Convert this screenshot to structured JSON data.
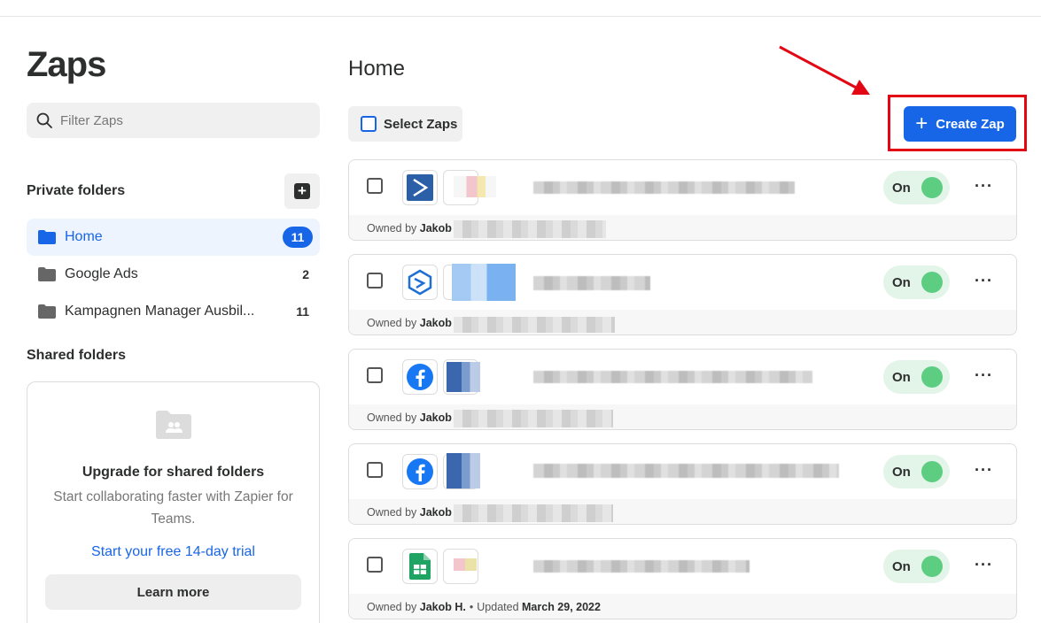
{
  "sidebar": {
    "title": "Zaps",
    "filter_placeholder": "Filter Zaps",
    "private_folders_label": "Private folders",
    "folders": [
      {
        "name": "Home",
        "count": "11",
        "active": true
      },
      {
        "name": "Google Ads",
        "count": "2",
        "active": false
      },
      {
        "name": "Kampagnen Manager Ausbil...",
        "count": "11",
        "active": false
      }
    ],
    "shared_folders_label": "Shared folders",
    "upgrade": {
      "heading": "Upgrade for shared folders",
      "body": "Start collaborating faster with Zapier for Teams.",
      "trial_link": "Start your free 14-day trial",
      "button": "Learn more"
    }
  },
  "main": {
    "title": "Home",
    "select_zaps_label": "Select Zaps",
    "create_zap_label": "Create Zap",
    "zaps": [
      {
        "icon": "arrow-app-icon",
        "status": "On",
        "owner_prefix": "Owned by",
        "owner": "Jakob",
        "updated_label": "",
        "updated": ""
      },
      {
        "icon": "s-logo-app-icon",
        "status": "On",
        "owner_prefix": "Owned by",
        "owner": "Jakob",
        "updated_label": "",
        "updated": ""
      },
      {
        "icon": "facebook-icon",
        "status": "On",
        "owner_prefix": "Owned by",
        "owner": "Jakob",
        "updated_label": "",
        "updated": ""
      },
      {
        "icon": "facebook-icon",
        "status": "On",
        "owner_prefix": "Owned by",
        "owner": "Jakob",
        "updated_label": "",
        "updated": ""
      },
      {
        "icon": "google-sheets-icon",
        "status": "On",
        "owner_prefix": "Owned by",
        "owner": "Jakob H.",
        "updated_label": "Updated",
        "updated": "March 29, 2022"
      }
    ]
  },
  "colors": {
    "accent": "#1766e8",
    "toggle_on_bg": "#e3f4e9",
    "toggle_knob": "#5ccd81",
    "annotation": "#e30613"
  }
}
